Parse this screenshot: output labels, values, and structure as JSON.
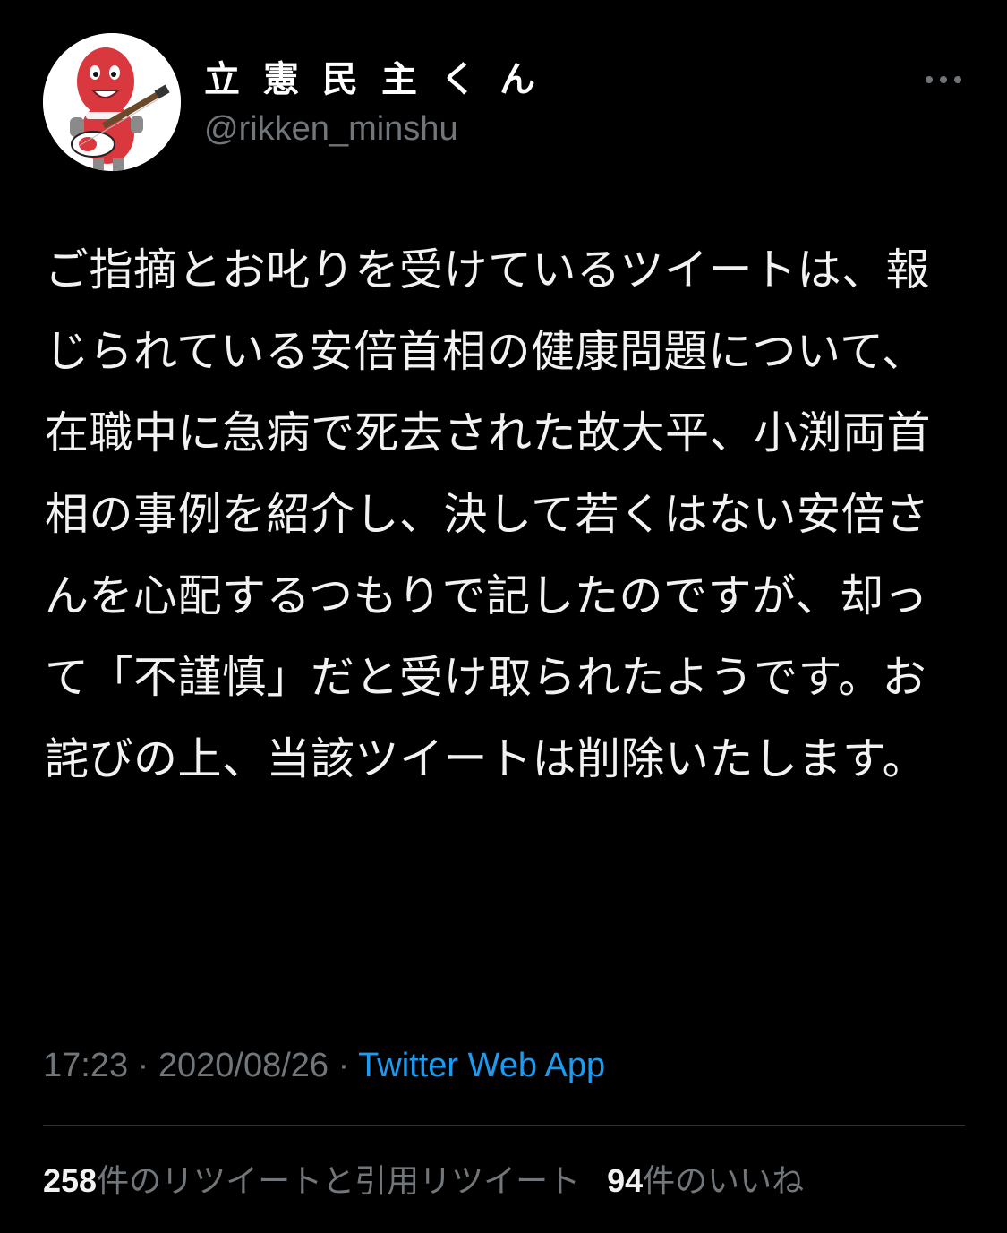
{
  "user": {
    "display_name": "立憲民主くん",
    "handle": "@rikken_minshu"
  },
  "tweet": {
    "text": "ご指摘とお叱りを受けているツイートは、報じられている安倍首相の健康問題について、在職中に急病で死去された故大平、小渕両首相の事例を紹介し、決して若くはない安倍さんを心配するつもりで記したのですが、却って「不謹慎」だと受け取られたようです。お詫びの上、当該ツイートは削除いたします。"
  },
  "meta": {
    "time": "17:23",
    "separator": " · ",
    "date": "2020/08/26",
    "source": "Twitter Web App"
  },
  "stats": {
    "retweets_count": "258",
    "retweets_label": "件のリツイートと引用リツイート",
    "likes_count": "94",
    "likes_label": "件のいいね"
  },
  "icons": {
    "more": "more-horizontal-icon",
    "avatar": "mascot-avatar"
  },
  "colors": {
    "background": "#000000",
    "text": "#f2f2f2",
    "secondary": "#71767b",
    "link": "#1d9bf0",
    "divider": "#2f3336",
    "mascot_red": "#d9383e"
  }
}
